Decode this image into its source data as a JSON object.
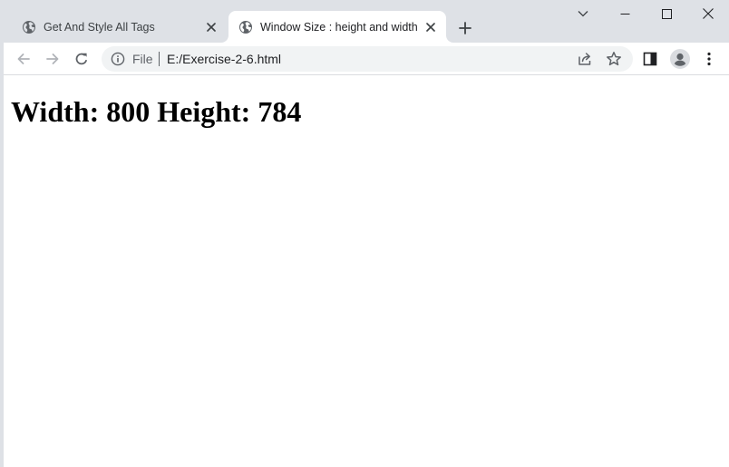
{
  "browser": {
    "tabs": [
      {
        "title": "Get And Style All Tags",
        "active": false,
        "favicon": "globe-icon"
      },
      {
        "title": "Window Size : height and width",
        "active": true,
        "favicon": "globe-icon"
      }
    ],
    "address": {
      "scheme_label": "File",
      "url": "E:/Exercise-2-6.html"
    }
  },
  "page": {
    "heading": "Width: 800 Height: 784"
  },
  "colors": {
    "tabstrip": "#dee1e6",
    "omnibox": "#f1f3f4",
    "icon": "#5f6368"
  }
}
